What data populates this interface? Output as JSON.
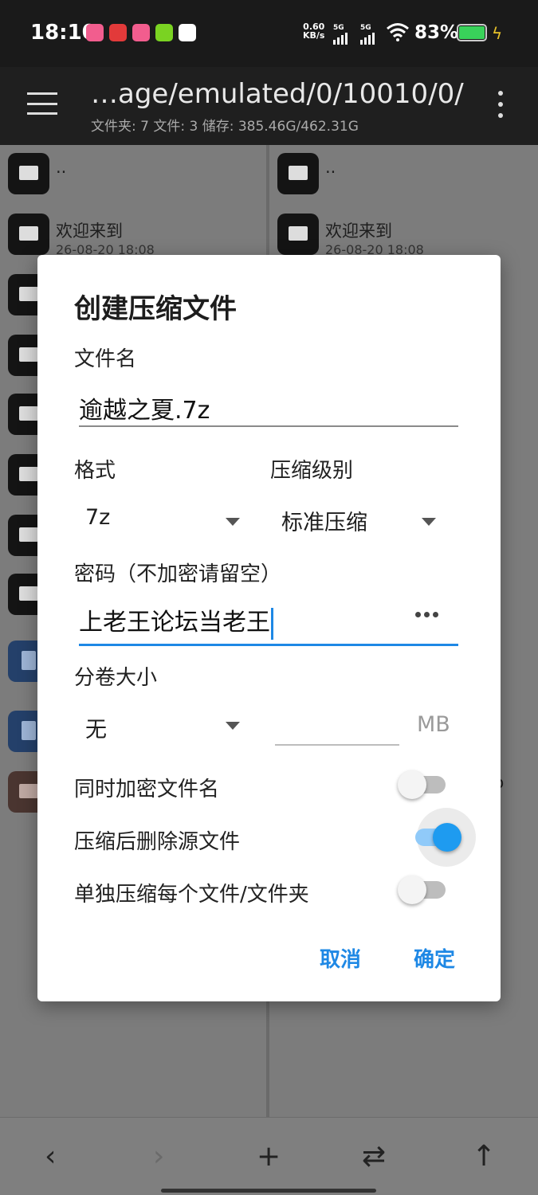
{
  "status_bar": {
    "time": "18:10",
    "net_speed_value": "0.60",
    "net_speed_unit": "KB/s",
    "signal1_label": "5G",
    "signal2_label": "5G",
    "battery_percent": "83%",
    "colors": {
      "battery": "#39d25a",
      "charging": "#e8c22a"
    }
  },
  "toolbar": {
    "path": "…age/emulated/0/10010/0/",
    "stats": "文件夹: 7  文件: 3  储存: 385.46G/462.31G"
  },
  "left_pane": {
    "rows": [
      {
        "name": "..",
        "date": ""
      },
      {
        "name": "欢迎来到",
        "date": "26-08-20 18:08"
      }
    ]
  },
  "right_pane": {
    "rows": [
      {
        "name": "..",
        "date": ""
      },
      {
        "name": "欢迎来到",
        "date": "26-08-20 18:08"
      }
    ],
    "peek_text": "o"
  },
  "dialog": {
    "title": "创建压缩文件",
    "filename_label": "文件名",
    "filename_value": "逾越之夏.7z",
    "format_label": "格式",
    "format_value": "7z",
    "level_label": "压缩级别",
    "level_value": "标准压缩",
    "password_label": "密码（不加密请留空）",
    "password_value": "上老王论坛当老王",
    "volume_label": "分卷大小",
    "volume_value": "无",
    "volume_unit": "MB",
    "toggles": [
      {
        "label": "同时加密文件名",
        "on": false
      },
      {
        "label": "压缩后删除源文件",
        "on": true
      },
      {
        "label": "单独压缩每个文件/文件夹",
        "on": false
      }
    ],
    "cancel_label": "取消",
    "ok_label": "确定",
    "accent_color": "#1e88e5"
  },
  "bottom_nav": {
    "back_glyph": "‹",
    "forward_glyph": "›",
    "add_glyph": "+",
    "swap_glyph": "⇄",
    "up_glyph": "↑"
  }
}
